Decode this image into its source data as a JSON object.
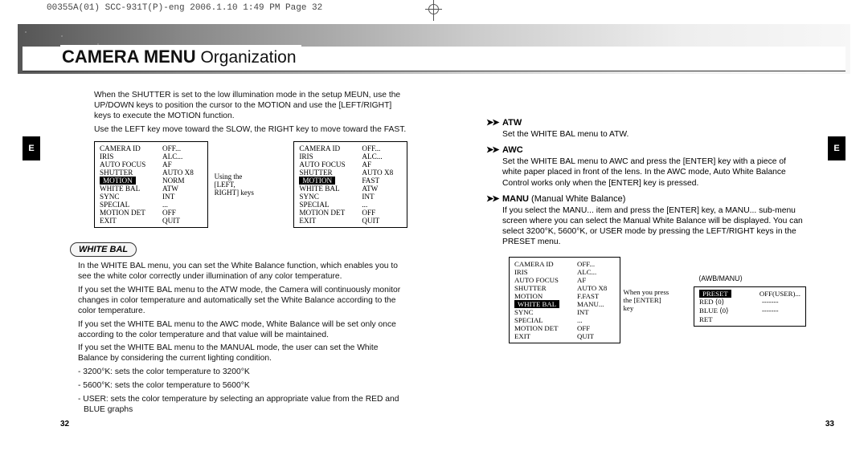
{
  "meta": {
    "top_line": "00355A(01) SCC-931T(P)-eng  2006.1.10  1:49 PM  Page 32"
  },
  "header": {
    "title_strong": "CAMERA MENU",
    "title_light": " Organization"
  },
  "side": {
    "label": "E",
    "page_left": "32",
    "page_right": "33"
  },
  "left": {
    "para1": "When the SHUTTER is set to the low illumination mode in the setup MEUN, use the UP/DOWN keys to position the cursor to the MOTION and use the [LEFT/RIGHT] keys to execute the MOTION function.",
    "para2": "Use the LEFT key move toward the SLOW, the RIGHT key to move toward the FAST.",
    "keys_note": "Using the [LEFT, RIGHT] keys",
    "menuA": [
      {
        "l": "CAMERA ID",
        "v": "OFF..."
      },
      {
        "l": "IRIS",
        "v": "ALC..."
      },
      {
        "l": "AUTO FOCUS",
        "v": "AF"
      },
      {
        "l": "SHUTTER",
        "v": "AUTO X8"
      },
      {
        "l": "MOTION",
        "v": "NORM",
        "hi": true
      },
      {
        "l": "WHITE BAL",
        "v": "ATW"
      },
      {
        "l": "SYNC",
        "v": "INT"
      },
      {
        "l": "SPECIAL",
        "v": "..."
      },
      {
        "l": "MOTION DET",
        "v": "OFF"
      },
      {
        "l": "EXIT",
        "v": "QUIT"
      }
    ],
    "menuB": [
      {
        "l": "CAMERA ID",
        "v": "OFF..."
      },
      {
        "l": "IRIS",
        "v": "ALC..."
      },
      {
        "l": "AUTO FOCUS",
        "v": "AF"
      },
      {
        "l": "SHUTTER",
        "v": "AUTO X8"
      },
      {
        "l": "MOTION",
        "v": "FAST",
        "hi": true
      },
      {
        "l": "WHITE BAL",
        "v": "ATW"
      },
      {
        "l": "SYNC",
        "v": "INT"
      },
      {
        "l": "SPECIAL",
        "v": "..."
      },
      {
        "l": "MOTION DET",
        "v": "OFF"
      },
      {
        "l": "EXIT",
        "v": "QUIT"
      }
    ],
    "section_title": "WHITE BAL",
    "wb_p1": "In the WHITE BAL menu, you can set the White Balance function, which enables you to see the white color correctly under illumination of any color temperature.",
    "wb_p2": "If you set the WHITE BAL menu to the ATW mode, the Camera will continuously monitor changes in color temperature and automatically set the White Balance according to the color temperature.",
    "wb_p3": "If you set the WHITE BAL menu to the AWC mode, White Balance will be set only once according to the color temperature and that value will be maintained.",
    "wb_p4": "If you set the WHITE BAL menu to the MANUAL mode, the user can set the White Balance by considering the current lighting condition.",
    "wb_b1": "- 3200°K: sets the color temperature to 3200°K",
    "wb_b2": "- 5600°K: sets the color temperature to 5600°K",
    "wb_b3": "- USER: sets the color temperature by selecting an appropriate value from the RED and BLUE graphs"
  },
  "right": {
    "atw_title": "ATW",
    "atw_body": "Set the WHITE BAL menu to ATW.",
    "awc_title": "AWC",
    "awc_body": "Set the WHITE BAL menu to AWC and press the [ENTER] key with a piece of white paper placed in front of the lens. In the AWC mode, Auto White Balance Control works only when the [ENTER] key is pressed.",
    "manu_title_bold": "MANU",
    "manu_title_rest": " (Manual White Balance)",
    "manu_body": "If you select the MANU... item and press the [ENTER] key, a MANU... sub-menu screen where you can select the Manual White Balance will be displayed. You can select 3200°K, 5600°K, or USER mode by pressing the LEFT/RIGHT keys in the PRESET menu.",
    "enter_note": "When you press the [ENTER] key",
    "menuC": [
      {
        "l": "CAMERA ID",
        "v": "OFF..."
      },
      {
        "l": "IRIS",
        "v": "ALC..."
      },
      {
        "l": "AUTO FOCUS",
        "v": "AF"
      },
      {
        "l": "SHUTTER",
        "v": "AUTO X8"
      },
      {
        "l": "MOTION",
        "v": "F.FAST"
      },
      {
        "l": "WHITE BAL",
        "v": "MANU...",
        "hi": true
      },
      {
        "l": "SYNC",
        "v": "INT"
      },
      {
        "l": "SPECIAL",
        "v": "..."
      },
      {
        "l": "MOTION DET",
        "v": "OFF"
      },
      {
        "l": "EXIT",
        "v": "QUIT"
      }
    ],
    "awb_head": "⟨AWB/MANU⟩",
    "menuD": [
      {
        "l": "PRESET",
        "v": "OFF(USER)...",
        "hi": true
      },
      {
        "l": "RED   ⟨0⟩",
        "v": "-------"
      },
      {
        "l": "BLUE ⟨0⟩",
        "v": "-------"
      },
      {
        "l": "RET",
        "v": ""
      }
    ]
  }
}
